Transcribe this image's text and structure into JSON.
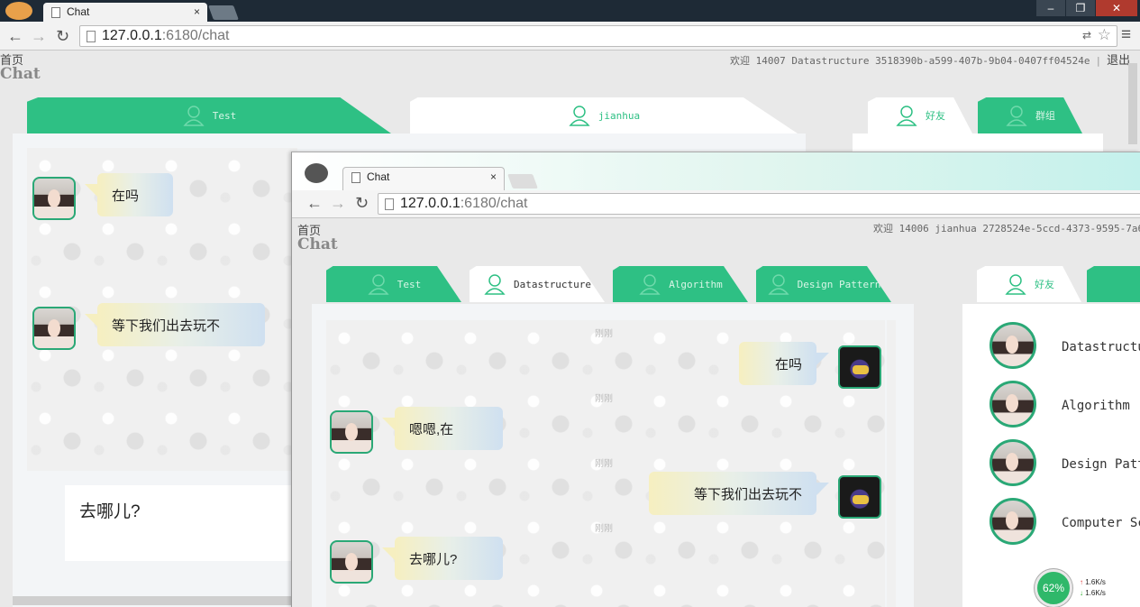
{
  "browser": {
    "tab_title": "Chat",
    "tab_close": "×",
    "url_host": "127.0.0.1",
    "url_port_path": ":6180/chat",
    "win_controls": [
      "–",
      "❐",
      "✕"
    ]
  },
  "page1": {
    "home_link": "首页",
    "brand": "Chat",
    "welcome": "欢迎 14007 Datastructure 3518390b-a599-407b-9b04-0407ff04524e",
    "logout": "退出",
    "tabs": [
      {
        "label": "Test"
      },
      {
        "label": "jianhua"
      }
    ],
    "side_tabs": [
      {
        "label": "好友"
      },
      {
        "label": "群组"
      }
    ],
    "messages": [
      {
        "text": "在吗"
      },
      {
        "text": "等下我们出去玩不"
      }
    ],
    "input_value": "去哪儿?"
  },
  "page2": {
    "tab_title": "Chat",
    "tab_close": "×",
    "url_host": "127.0.0.1",
    "url_port_path": ":6180/chat",
    "home_link": "首页",
    "brand": "Chat",
    "welcome": "欢迎 14006 jianhua 2728524e-5ccd-4373-9595-7a6",
    "tabs": [
      {
        "label": "Test"
      },
      {
        "label": "Datastructure"
      },
      {
        "label": "Algorithm"
      },
      {
        "label": "Design Pattern"
      }
    ],
    "side_tab": "好友",
    "messages": [
      {
        "ts": "刚刚",
        "text": "在吗"
      },
      {
        "ts": "刚刚",
        "text": "嗯嗯,在"
      },
      {
        "ts": "刚刚",
        "text": "等下我们出去玩不"
      },
      {
        "ts": "刚刚",
        "text": "去哪儿?"
      }
    ],
    "contacts": [
      {
        "name": "Datastructu"
      },
      {
        "name": "Algorithm"
      },
      {
        "name": "Design Patt"
      },
      {
        "name": "Computer Sc"
      }
    ]
  },
  "net_widget": {
    "percent": "62%",
    "up": "1.6K/s",
    "down": "1.6K/s"
  },
  "colors": {
    "accent": "#2ec084",
    "avatar_border": "#2aa876"
  }
}
